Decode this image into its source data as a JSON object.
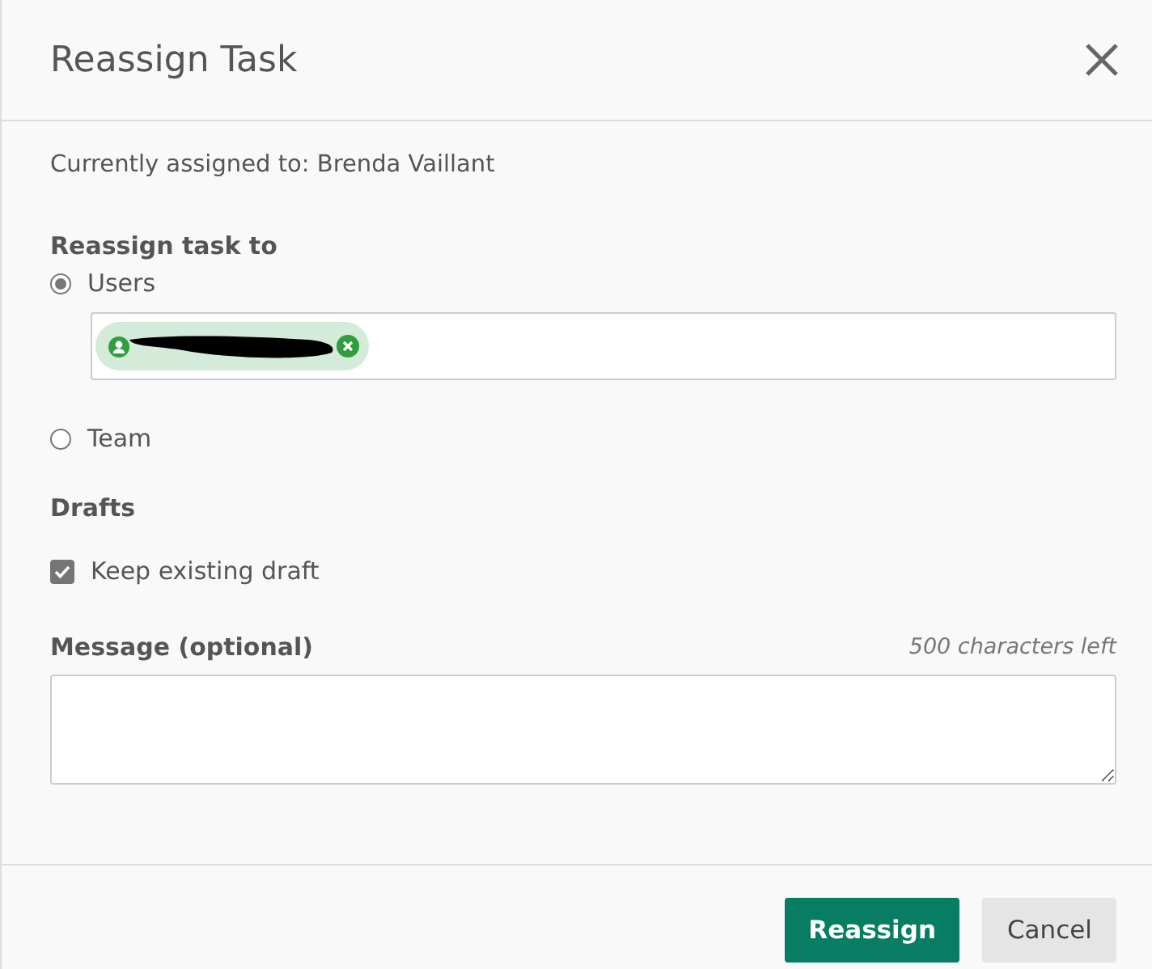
{
  "dialog": {
    "title": "Reassign Task",
    "current_assignment": "Currently assigned to: Brenda Vaillant",
    "reassign_section": {
      "heading": "Reassign task to",
      "options": [
        {
          "label": "Users",
          "selected": true,
          "chips": [
            {
              "kind": "user"
            }
          ]
        },
        {
          "label": "Team",
          "selected": false
        }
      ]
    },
    "drafts": {
      "heading": "Drafts",
      "options": [
        {
          "label": "Keep existing draft",
          "checked": true
        }
      ]
    },
    "message": {
      "label": "Message (optional)",
      "counter": "500 characters left"
    },
    "buttons": [
      {
        "label": "Reassign",
        "kind": "primary"
      },
      {
        "label": "Cancel",
        "kind": "secondary"
      }
    ]
  }
}
